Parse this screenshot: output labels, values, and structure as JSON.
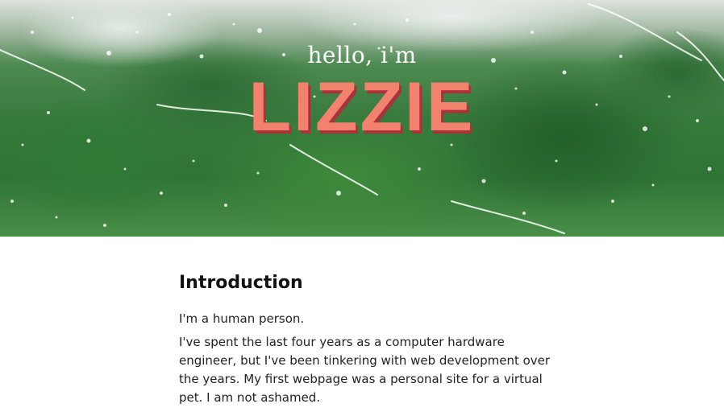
{
  "hero": {
    "greeting": "hello, i'm",
    "name": "LIZZIE",
    "colors": {
      "name_fill": "#f2826d",
      "name_shadow": "#a8333a"
    },
    "background": "rain-on-window-green-trees"
  },
  "main": {
    "heading": "Introduction",
    "paragraphs": [
      "I'm a human person.",
      "I've spent the last four years as a computer hardware engineer, but I've been tinkering with web development over the years. My first webpage was a personal site for a virtual pet. I am not ashamed."
    ]
  }
}
